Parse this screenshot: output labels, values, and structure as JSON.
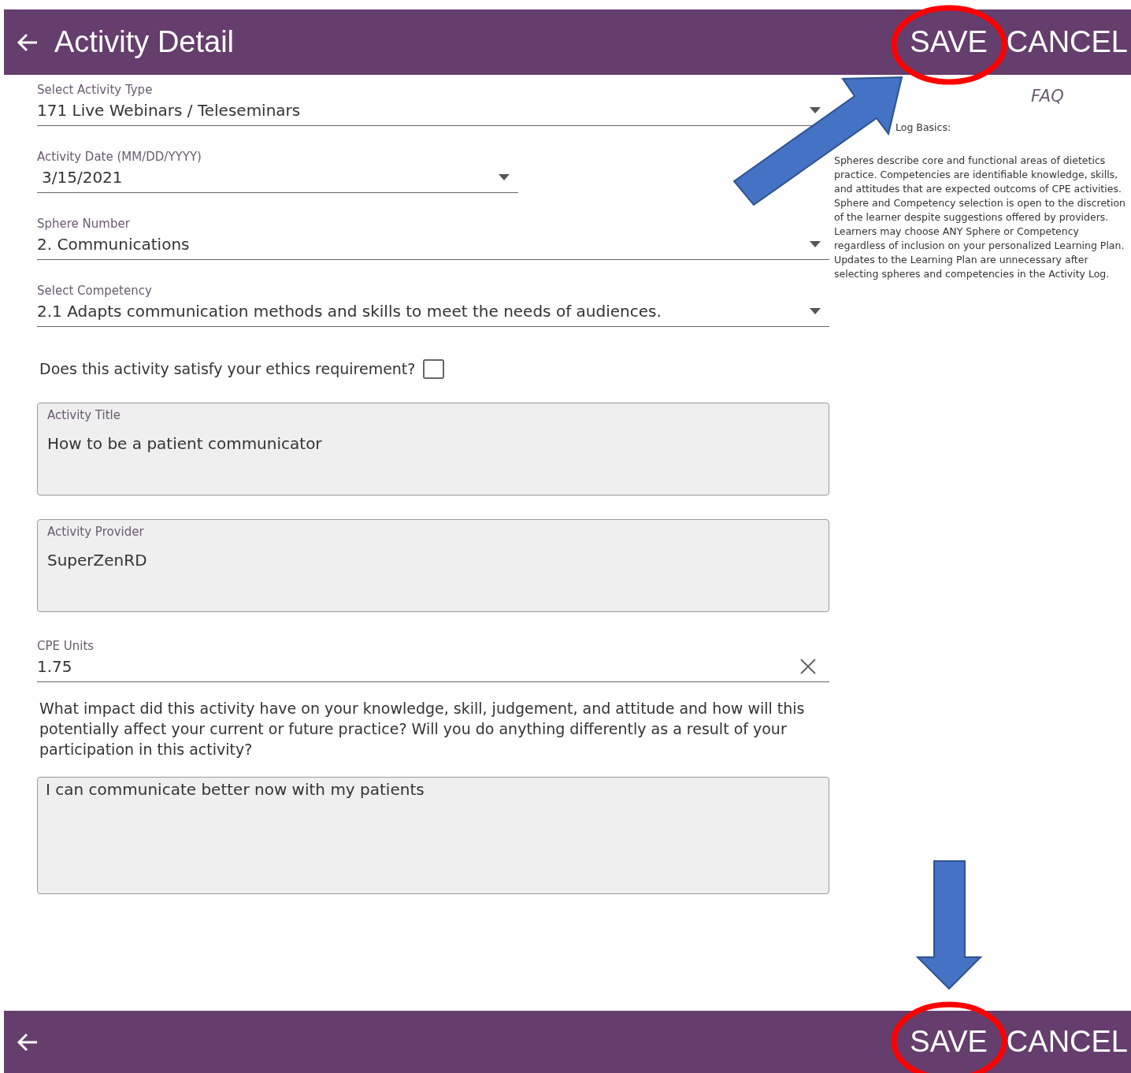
{
  "header": {
    "title": "Activity Detail",
    "actions": [
      "SAVE",
      "CANCEL"
    ]
  },
  "form": [
    {
      "kind": "select",
      "label": "Select Activity Type",
      "value": "171 Live Webinars / Teleseminars"
    },
    {
      "kind": "date",
      "label": "Activity Date (MM/DD/YYYY)",
      "value": "3/15/2021"
    },
    {
      "kind": "select",
      "label": "Sphere Number",
      "value": "2. Communications"
    },
    {
      "kind": "select",
      "label": "Select Competency",
      "value": "2.1 Adapts communication methods and skills to meet the needs of audiences."
    },
    {
      "kind": "checkbox",
      "label": "Does this activity satisfy your ethics requirement?",
      "checked": false
    },
    {
      "kind": "box",
      "label": "Activity Title",
      "value": "How to be a patient communicator"
    },
    {
      "kind": "box",
      "label": "Activity Provider",
      "value": "SuperZenRD"
    },
    {
      "kind": "clearable",
      "label": "CPE Units",
      "value": "1.75"
    },
    {
      "kind": "question",
      "text": "What impact did this activity have on your knowledge, skill, judgement, and attitude and how will this potentially affect your current or future practice? Will you do anything differently as a result of your participation in this activity?"
    },
    {
      "kind": "textarea",
      "value": "I can communicate better now with my patients"
    }
  ],
  "faq": {
    "link": "FAQ",
    "heading": "Log Basics:",
    "text": "Spheres describe core and functional areas of dietetics practice.  Competencies are identifiable knowledge, skills, and attitudes that are expected outcoms of CPE activities.  Sphere and Competency selection is open to the discretion of the learner despite suggestions offered by providers.  Learners may choose ANY Sphere or Competency regardless of inclusion on your personalized Learning Plan.  Updates to the Learning Plan are unnecessary after selecting spheres and competencies in the Activity Log."
  },
  "footer": {
    "actions": [
      "SAVE",
      "CANCEL"
    ]
  }
}
